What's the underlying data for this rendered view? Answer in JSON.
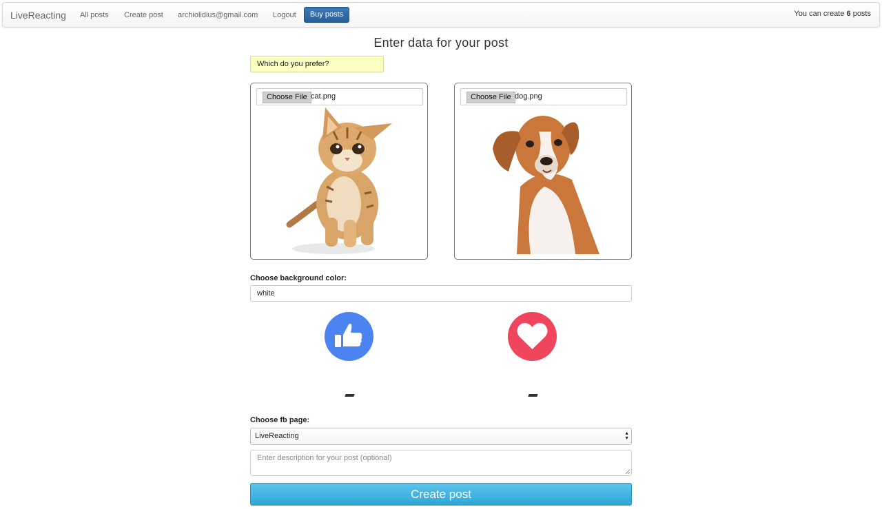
{
  "navbar": {
    "brand": "LiveReacting",
    "links": [
      "All posts",
      "Create post",
      "archiolidius@gmail.com",
      "Logout"
    ],
    "buy_label": "Buy posts",
    "quota_prefix": "You can create ",
    "quota_count": "6",
    "quota_suffix": " posts"
  },
  "main": {
    "title": "Enter data for your post",
    "question": "Which do you prefer?",
    "options": [
      {
        "button": "Choose File",
        "filename": "cat.png"
      },
      {
        "button": "Choose File",
        "filename": "dog.png"
      }
    ],
    "bg_label": "Choose background color:",
    "bg_value": "white",
    "reactions": [
      {
        "icon": "like-icon",
        "color": "#4b83f0",
        "count": "-"
      },
      {
        "icon": "love-icon",
        "color": "#f0465d",
        "count": "-"
      }
    ],
    "fb_label": "Choose fb page:",
    "fb_selected": "LiveReacting",
    "description_placeholder": "Enter description for your post (optional)",
    "submit_label": "Create post"
  }
}
